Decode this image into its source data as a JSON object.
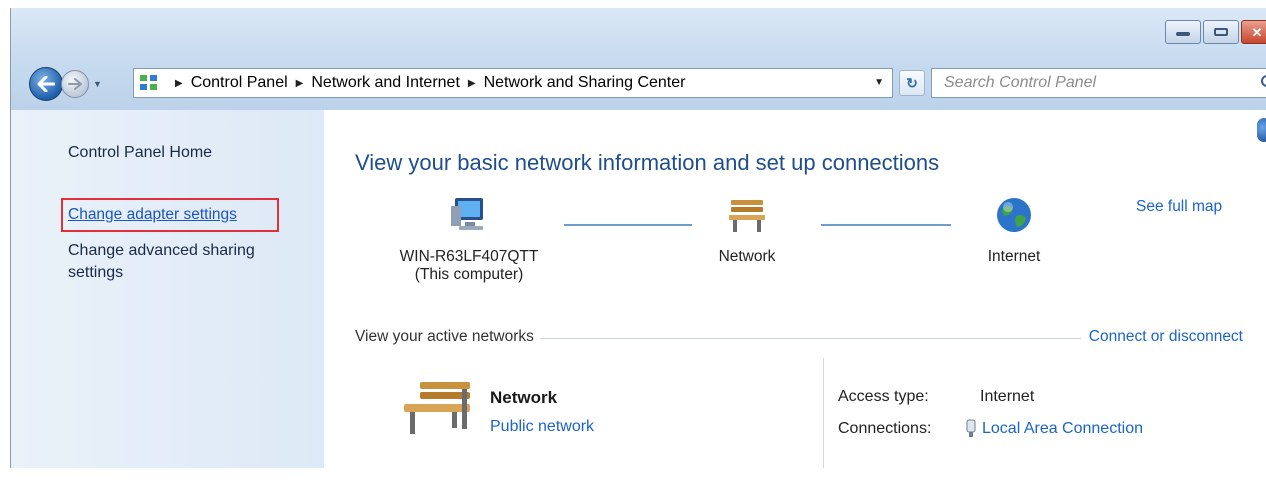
{
  "window": {
    "controls": [
      "minimize-icon",
      "maximize-icon",
      "close-icon"
    ]
  },
  "nav": {
    "back_icon": "back-arrow-icon",
    "forward_icon": "forward-arrow-icon",
    "breadcrumb": [
      "Control Panel",
      "Network and Internet",
      "Network and Sharing Center"
    ],
    "refresh_icon": "refresh-icon",
    "search_placeholder": "Search Control Panel"
  },
  "sidebar": {
    "home": "Control Panel Home",
    "links": [
      {
        "label": "Change adapter settings",
        "highlighted": true
      },
      {
        "label": "Change advanced sharing settings"
      }
    ]
  },
  "main": {
    "heading": "View your basic network information and set up connections",
    "see_full_map": "See full map",
    "map_nodes": [
      {
        "label": "WIN-R63LF407QTT",
        "sublabel": "(This computer)",
        "icon": "computer-icon"
      },
      {
        "label": "Network",
        "icon": "bench-icon"
      },
      {
        "label": "Internet",
        "icon": "globe-icon"
      }
    ],
    "active_networks_label": "View your active networks",
    "connect_disconnect": "Connect or disconnect",
    "active_network": {
      "name": "Network",
      "type": "Public network",
      "icon": "bench-icon",
      "access_type_label": "Access type:",
      "access_type_value": "Internet",
      "connections_label": "Connections:",
      "connections_value": "Local Area Connection"
    }
  },
  "colors": {
    "link": "#1b64c8",
    "heading": "#1f4e8d",
    "highlight_box": "#e0303a",
    "sidebar_bg": "#e3edf8"
  }
}
